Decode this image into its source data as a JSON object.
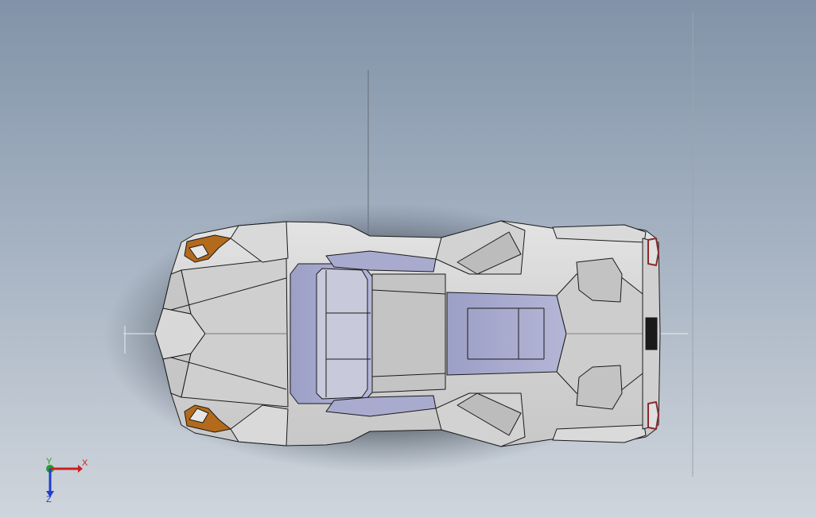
{
  "viewport": {
    "background_top": "#8193a8",
    "background_bottom": "#cfd5dc"
  },
  "model": {
    "body_color": "#d4d4d4",
    "body_shade": "#bdbdbd",
    "edge_color": "#1a1a1a",
    "glass_color": "#a7a9cc",
    "accent_color": "#b36a1c",
    "lamp_color": "#8a2a2a"
  },
  "triad": {
    "x_label": "X",
    "y_label": "Y",
    "z_label": "Z",
    "x_color": "#cc1f1f",
    "y_color": "#1fa02a",
    "z_color": "#1f3fcc"
  }
}
